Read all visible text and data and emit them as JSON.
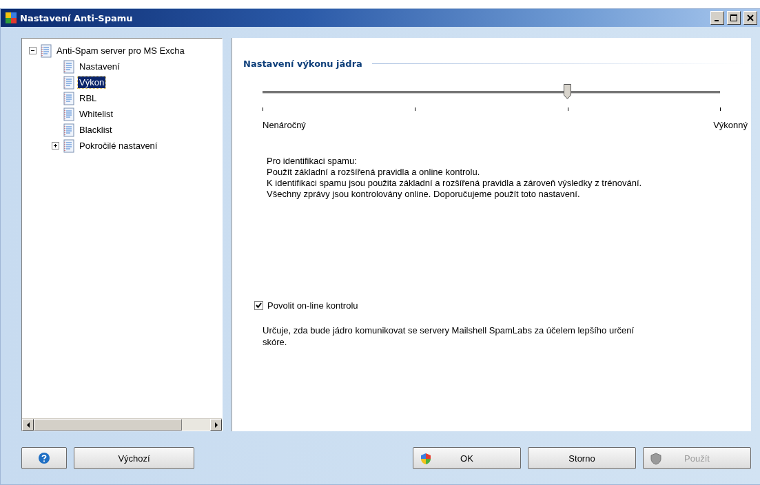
{
  "window": {
    "title": "Nastavení Anti-Spamu"
  },
  "tree": [
    {
      "label": "Anti-Spam server pro MS Excha",
      "selected": false,
      "expanded": true,
      "children": [
        {
          "label": "Nastavení",
          "selected": false
        },
        {
          "label": "Výkon",
          "selected": true
        },
        {
          "label": "RBL",
          "selected": false
        },
        {
          "label": "Whitelist",
          "selected": false
        },
        {
          "label": "Blacklist",
          "selected": false
        },
        {
          "label": "Pokročilé nastavení",
          "selected": false,
          "expanded": false
        }
      ]
    }
  ],
  "section": {
    "title": "Nastavení výkonu jádra"
  },
  "slider": {
    "level": 0.667,
    "min_label": "Nenáročný",
    "max_label": "Výkonný"
  },
  "description": [
    "Pro identifikaci spamu:",
    "Použít základní a rozšířená pravidla a online kontrolu.",
    "K identifikaci spamu jsou použita základní a rozšířená pravidla a zároveň výsledky z trénování.",
    "Všechny zprávy jsou kontrolovány online. Doporučujeme použít toto nastavení."
  ],
  "online_check": {
    "label": "Povolit on-line kontrolu",
    "checked": true,
    "description": "Určuje, zda bude jádro komunikovat se servery Mailshell SpamLabs za účelem lepšího určení skóre."
  },
  "buttons_left": [
    {
      "kind": "help"
    },
    {
      "kind": "text",
      "label": "Výchozí",
      "disabled": false
    }
  ],
  "buttons_right": [
    {
      "kind": "shield",
      "label": "OK",
      "disabled": false
    },
    {
      "kind": "text",
      "label": "Storno",
      "disabled": false
    },
    {
      "kind": "shield",
      "label": "Použít",
      "disabled": true
    }
  ]
}
